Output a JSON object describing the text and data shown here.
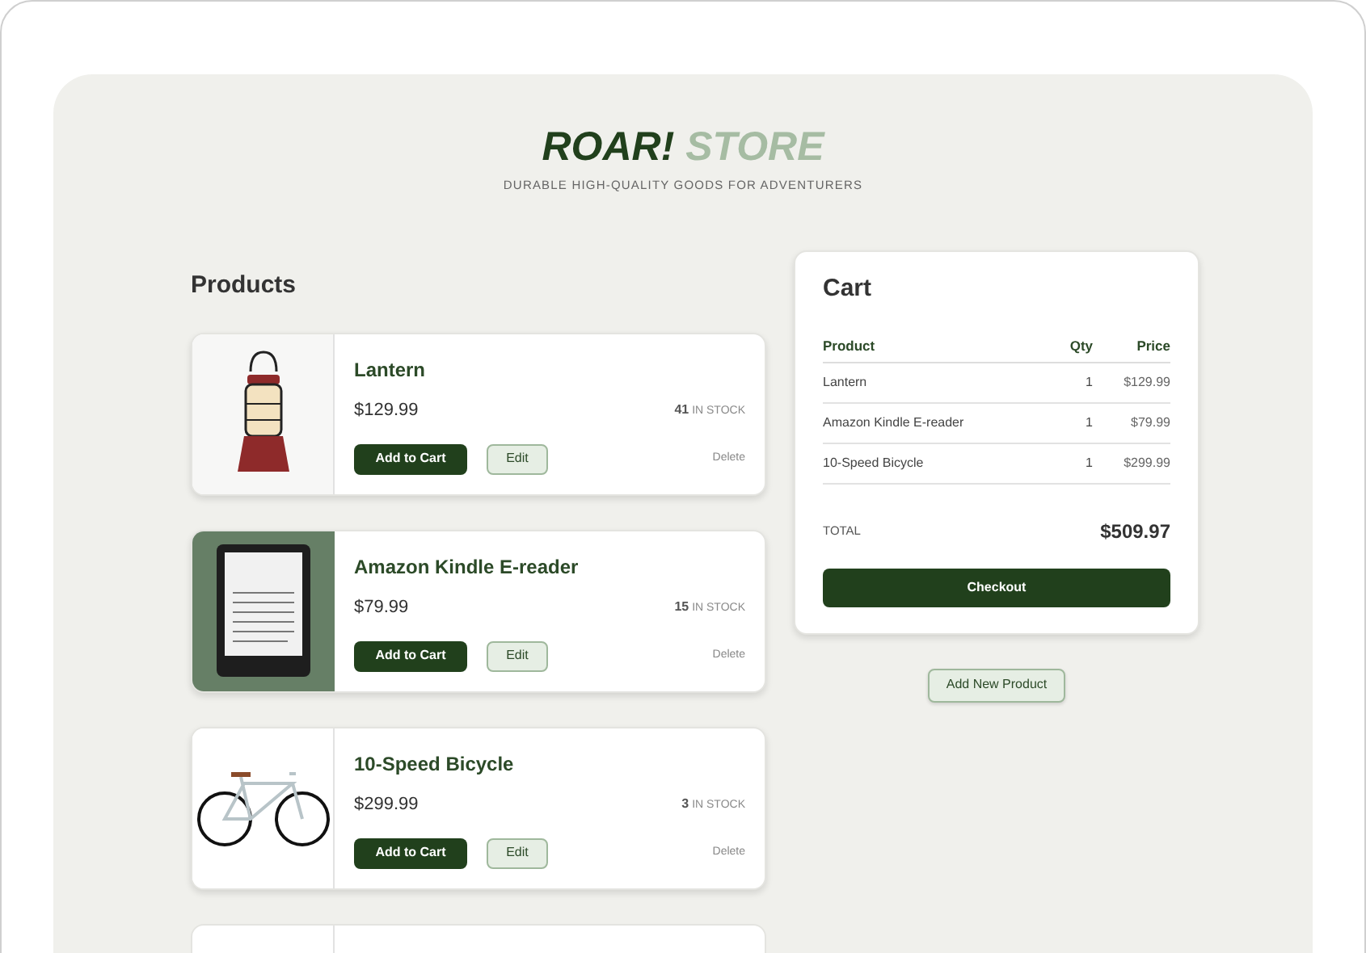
{
  "header": {
    "brand_primary": "ROAR!",
    "brand_secondary": "STORE",
    "tagline": "DURABLE HIGH-QUALITY GOODS FOR ADVENTURERS"
  },
  "products_title": "Products",
  "products": [
    {
      "name": "Lantern",
      "price": "$129.99",
      "stock_count": "41",
      "stock_label": "IN STOCK",
      "kind": "lantern",
      "add_label": "Add to Cart",
      "edit_label": "Edit",
      "delete_label": "Delete"
    },
    {
      "name": "Amazon Kindle E-reader",
      "price": "$79.99",
      "stock_count": "15",
      "stock_label": "IN STOCK",
      "kind": "ereader",
      "add_label": "Add to Cart",
      "edit_label": "Edit",
      "delete_label": "Delete"
    },
    {
      "name": "10-Speed Bicycle",
      "price": "$299.99",
      "stock_count": "3",
      "stock_label": "IN STOCK",
      "kind": "bicycle",
      "add_label": "Add to Cart",
      "edit_label": "Edit",
      "delete_label": "Delete"
    }
  ],
  "cart": {
    "title": "Cart",
    "columns": [
      "Product",
      "Qty",
      "Price"
    ],
    "rows": [
      {
        "product": "Lantern",
        "qty": "1",
        "price": "$129.99"
      },
      {
        "product": "Amazon Kindle E-reader",
        "qty": "1",
        "price": "$79.99"
      },
      {
        "product": "10-Speed Bicycle",
        "qty": "1",
        "price": "$299.99"
      }
    ],
    "total_label": "TOTAL",
    "total": "$509.97",
    "checkout_label": "Checkout"
  },
  "add_product_label": "Add New Product"
}
